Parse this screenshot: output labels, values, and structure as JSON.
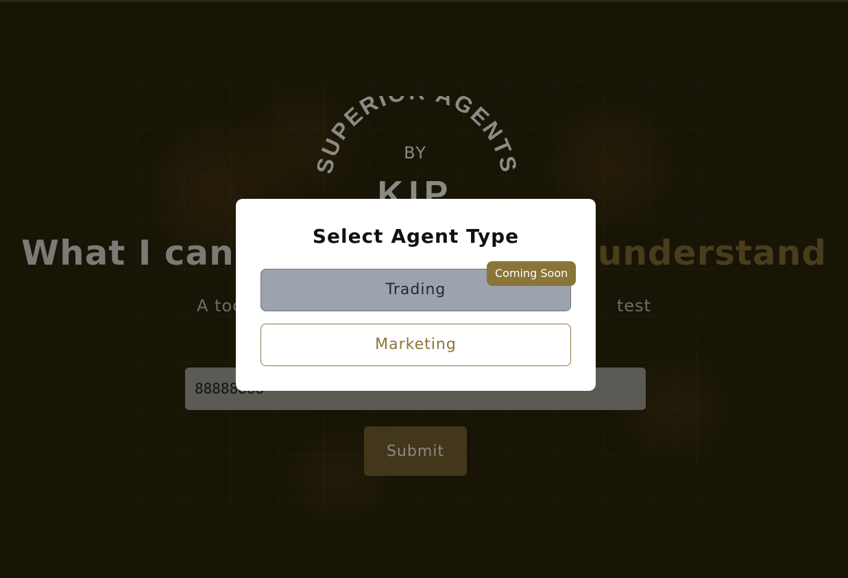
{
  "logo": {
    "arc_text": "SUPERIOR AGENTS",
    "by": "BY",
    "brand": "KIP"
  },
  "hero": {
    "title_start": "What I can",
    "title_end": "understand",
    "subtitle_start": "A too",
    "subtitle_end": "test"
  },
  "form": {
    "input_value": "88888888",
    "submit_label": "Submit"
  },
  "modal": {
    "title": "Select Agent Type",
    "options": [
      {
        "label": "Trading",
        "badge": "Coming Soon"
      },
      {
        "label": "Marketing"
      }
    ]
  },
  "colors": {
    "accent": "#8a7437",
    "background": "#0b0a05",
    "disabled_option": "#9ca3af"
  }
}
